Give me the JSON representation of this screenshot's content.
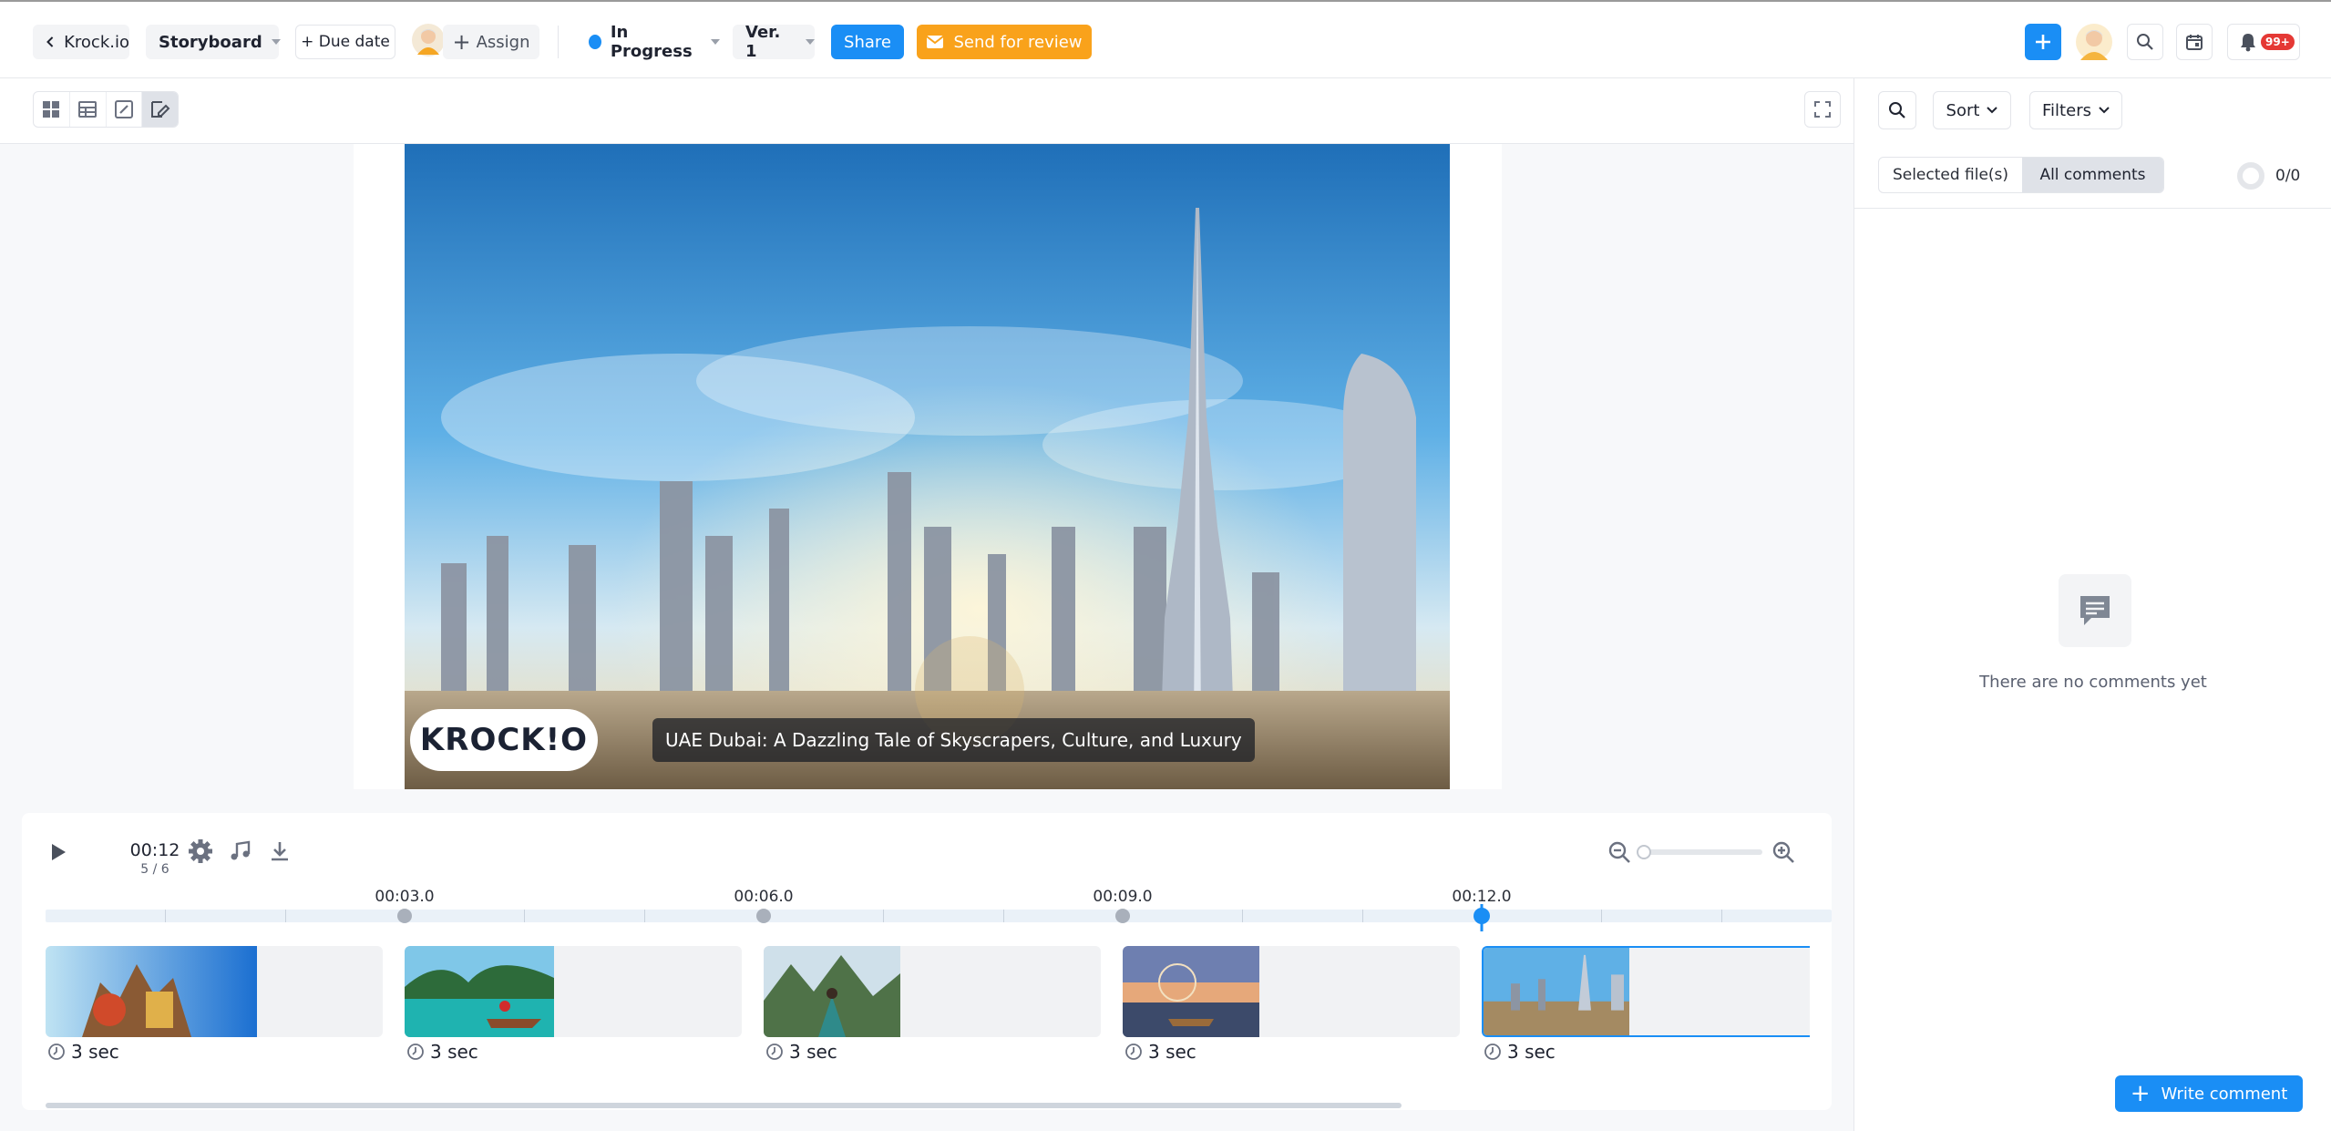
{
  "header": {
    "back_label": "Krock.io",
    "storyboard_label": "Storyboard",
    "due_date_label": "+ Due date",
    "assign_label": "Assign",
    "status_label": "In Progress",
    "status_color": "#1a8ef5",
    "version_label": "Ver. 1",
    "share_label": "Share",
    "send_review_label": "Send for review",
    "notification_badge": "99+"
  },
  "view_toolbar": {
    "icons": [
      "grid-icon",
      "table-icon",
      "edit-icon",
      "storyboard-edit-icon"
    ],
    "active": "storyboard-edit-icon"
  },
  "frame": {
    "logo_text": "KROCK!O",
    "caption": "UAE Dubai: A Dazzling Tale of Skyscrapers, Culture, and Luxury"
  },
  "timeline": {
    "current_time": "00:12",
    "frame_counter": "5 / 6",
    "ticks": [
      "00:03.0",
      "00:06.0",
      "00:09.0",
      "00:12.0"
    ],
    "clips": [
      {
        "duration": "3 sec",
        "scene": "travel-collage"
      },
      {
        "duration": "3 sec",
        "scene": "boat-lagoon"
      },
      {
        "duration": "3 sec",
        "scene": "machu-picchu"
      },
      {
        "duration": "3 sec",
        "scene": "canal-ferris-wheel"
      },
      {
        "duration": "3 sec",
        "scene": "dubai-skyline"
      }
    ],
    "active_clip": 4
  },
  "comments_panel": {
    "sort_label": "Sort",
    "filters_label": "Filters",
    "tab_selected_files": "Selected file(s)",
    "tab_all_comments": "All comments",
    "active_tab": "All comments",
    "counter": "0/0",
    "empty_text": "There are no comments yet",
    "write_comment_label": "Write comment"
  },
  "colors": {
    "accent": "#1a8ef5",
    "review": "#f9a21b",
    "badge": "#e53935"
  }
}
